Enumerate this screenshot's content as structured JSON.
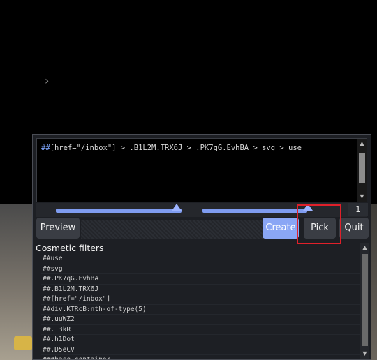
{
  "page": {
    "chevron_glyph": "›"
  },
  "picker": {
    "selector_prefix": "##",
    "selector_text": "[href=\"/inbox\"] > .B1L2M.TRX6J > .PK7qG.EvhBA > svg > use",
    "match_count": "1",
    "buttons": {
      "preview": "Preview",
      "create": "Create",
      "pick": "Pick",
      "quit": "Quit"
    },
    "section_title": "Cosmetic filters",
    "filters": [
      "##use",
      "##svg",
      "##.PK7qG.EvhBA",
      "##.B1L2M.TRX6J",
      "##[href=\"/inbox\"]",
      "##div.KTRcB:nth-of-type(5)",
      "##.uuWZ2",
      "##._3kR_",
      "##.h1Dot",
      "##.D5eCV",
      "###base-container"
    ],
    "colors": {
      "accent": "#8aa6f5",
      "highlight": "#e0202a",
      "panel_bg": "#1d1f24"
    }
  }
}
